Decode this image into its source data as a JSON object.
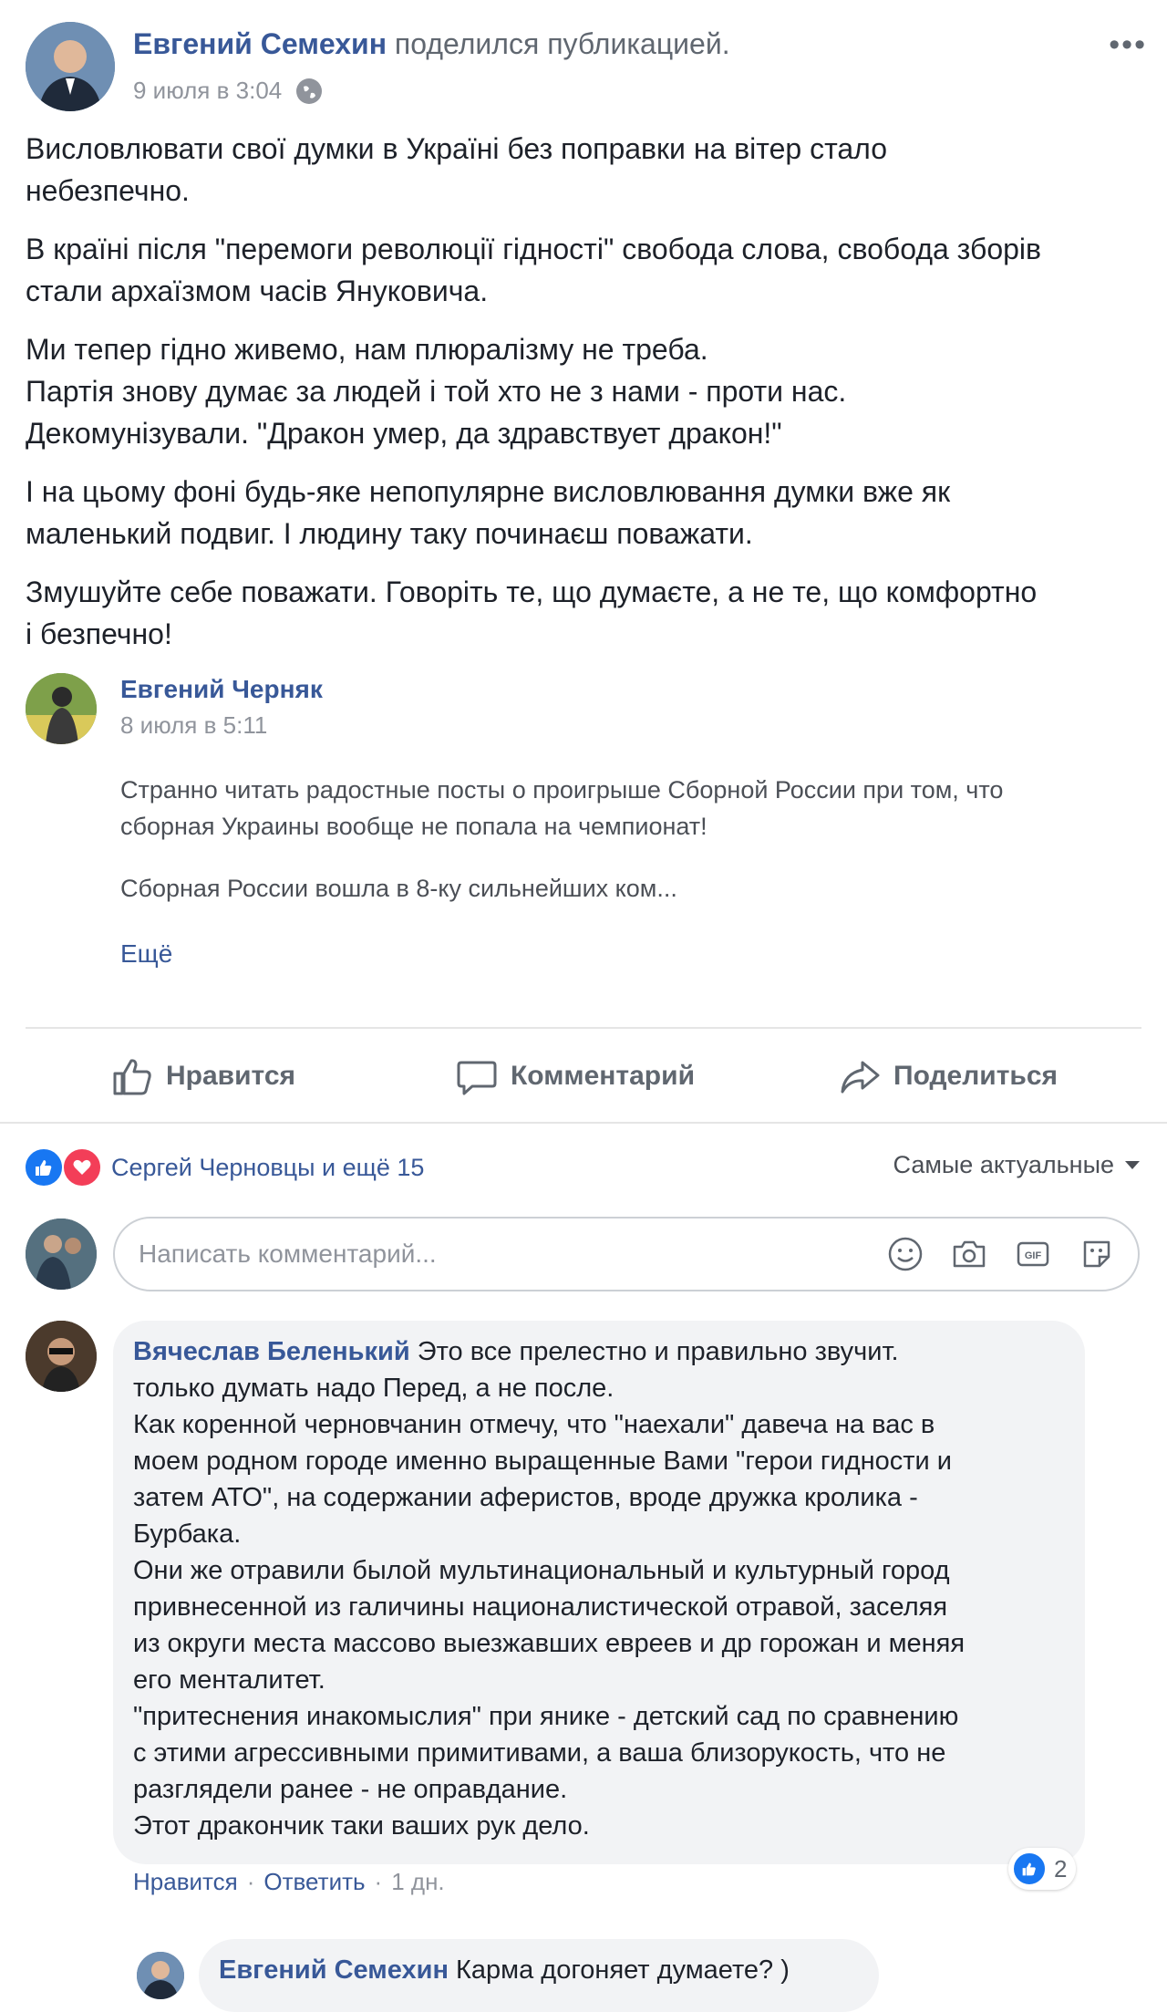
{
  "post": {
    "author": "Евгений Семехин",
    "action": "поделился публикацией.",
    "date": "9 июля в 3:04",
    "more_icon": "more-horizontal-icon",
    "privacy_icon": "globe-icon",
    "paragraphs": [
      "Висловлювати свої думки в Україні без поправки на вітер стало\nнебезпечно.",
      "В країні після \"перемоги революції гідності\" свобода слова, свобода зборів\nстали архаїзмом часів Януковича.",
      "Ми тепер гідно живемо, нам плюралізму не треба.\nПартія знову думає за людей і той хто не з нами - проти нас.\nДекомунізували. \"Дракон умер, да здравствует дракон!\"",
      "І на цьому фоні будь-яке непопулярне висловлювання думки вже як\nмаленький подвиг. І людину таку починаєш поважати.",
      "Змушуйте себе поважати. Говоріть те, що думаєте, а не те, що комфортно\nі безпечно!"
    ]
  },
  "shared": {
    "author": "Евгений Черняк",
    "date": "8 июля в 5:11",
    "paragraphs": [
      "Странно читать радостные посты о проигрыше Сборной России при том, что\nсборная Украины вообще не попала на чемпионат!",
      "Сборная России вошла в 8-ку сильнейших ком..."
    ],
    "more": "Ещё"
  },
  "actions": {
    "like": "Нравится",
    "comment": "Комментарий",
    "share": "Поделиться"
  },
  "reactions": {
    "text": "Сергей Черновцы и ещё 15",
    "sort": "Самые актуальные"
  },
  "comment_input": {
    "placeholder": "Написать комментарий...",
    "icons": [
      "emoji-icon",
      "camera-icon",
      "gif-icon",
      "sticker-icon"
    ]
  },
  "comments": [
    {
      "author": "Вячеслав Беленький",
      "text": "Это все прелестно и правильно звучит.\nтолько думать надо Перед, а не после.\nКак коренной черновчанин отмечу, что \"наехали\" давеча на вас в\nмоем родном городе именно выращенные Вами \"герои гидности и\nзатем АТО\", на содержании аферистов, вроде дружка кролика -\nБурбака.\nОни же отравили былой мультинациональный и культурный город\nпривнесенной из галичины националистической отравой, заселяя\nиз округи места массово выезжавших евреев и др горожан и меняя\nего менталитет.\n\"притеснения инакомыслия\" при янике - детский сад по сравнению\nс этими агрессивными примитивами, а ваша близорукость, что не\nразглядели ранее - не оправдание.\nЭтот дракончик таки ваших рук дело.",
      "like": "Нравится",
      "reply": "Ответить",
      "time": "1 дн.",
      "reaction_count": "2"
    }
  ],
  "reply": {
    "author": "Евгений Семехин",
    "text": "Карма догоняет думаете? )"
  },
  "colors": {
    "link": "#385898",
    "meta": "#90949c",
    "bubble": "#f2f3f5",
    "like_blue": "#1877f2",
    "love_red": "#f33e58"
  }
}
